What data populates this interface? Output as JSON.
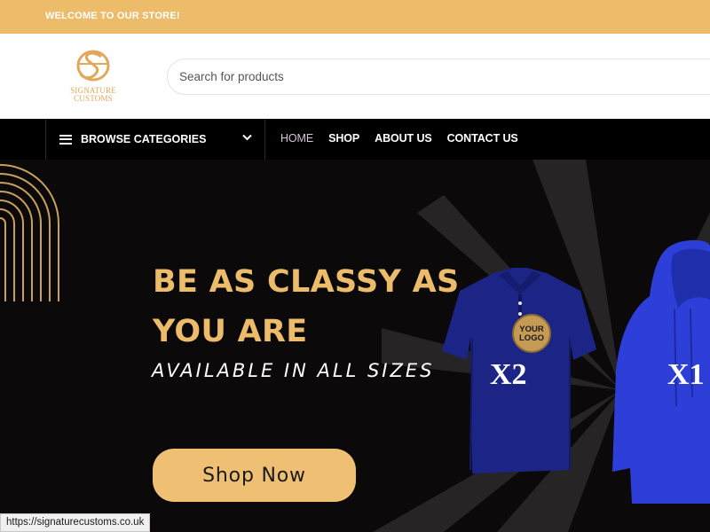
{
  "topbar": {
    "welcome": "WELCOME TO OUR STORE!"
  },
  "brand": {
    "line1": "SIGNATURE",
    "line2": "CUSTOMS",
    "color": "#e2a85a"
  },
  "search": {
    "placeholder": "Search for products",
    "value": ""
  },
  "nav": {
    "browse_label": "BROWSE CATEGORIES",
    "items": [
      {
        "label": "HOME",
        "active": true
      },
      {
        "label": "SHOP",
        "active": false
      },
      {
        "label": "ABOUT US",
        "active": false
      },
      {
        "label": "CONTACT US",
        "active": false
      }
    ]
  },
  "hero": {
    "title_line1": "BE AS CLASSY AS",
    "title_line2": "YOU ARE",
    "subtitle": "AVAILABLE IN ALL SIZES",
    "cta": "Shop Now",
    "badge_line1": "YOUR",
    "badge_line2": "LOGO",
    "shirt_qty": "X2",
    "hoodie_qty": "X1"
  },
  "status": {
    "url": "https://signaturecustoms.co.uk"
  },
  "colors": {
    "accent": "#ecbc6a",
    "dark": "#000000",
    "product_blue": "#1f2a8a"
  }
}
